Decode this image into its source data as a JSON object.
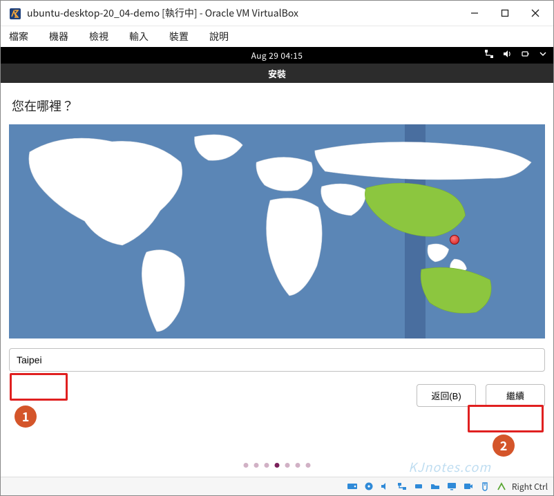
{
  "window": {
    "title": "ubuntu-desktop-20_04-demo [執行中] - Oracle VM VirtualBox"
  },
  "vb_menu": [
    "檔案",
    "機器",
    "檢視",
    "輸入",
    "裝置",
    "說明"
  ],
  "ubuntu": {
    "datetime": "Aug 29  04:15",
    "install_header": "安裝"
  },
  "installer": {
    "question": "您在哪裡？",
    "timezone_value": "Taipei",
    "back_label": "返回(B)",
    "continue_label": "繼續",
    "total_steps": 7,
    "active_step": 4
  },
  "callouts": {
    "one": "1",
    "two": "2"
  },
  "statusbar": {
    "host_key": "Right Ctrl"
  },
  "watermark": "KJnotes.com"
}
